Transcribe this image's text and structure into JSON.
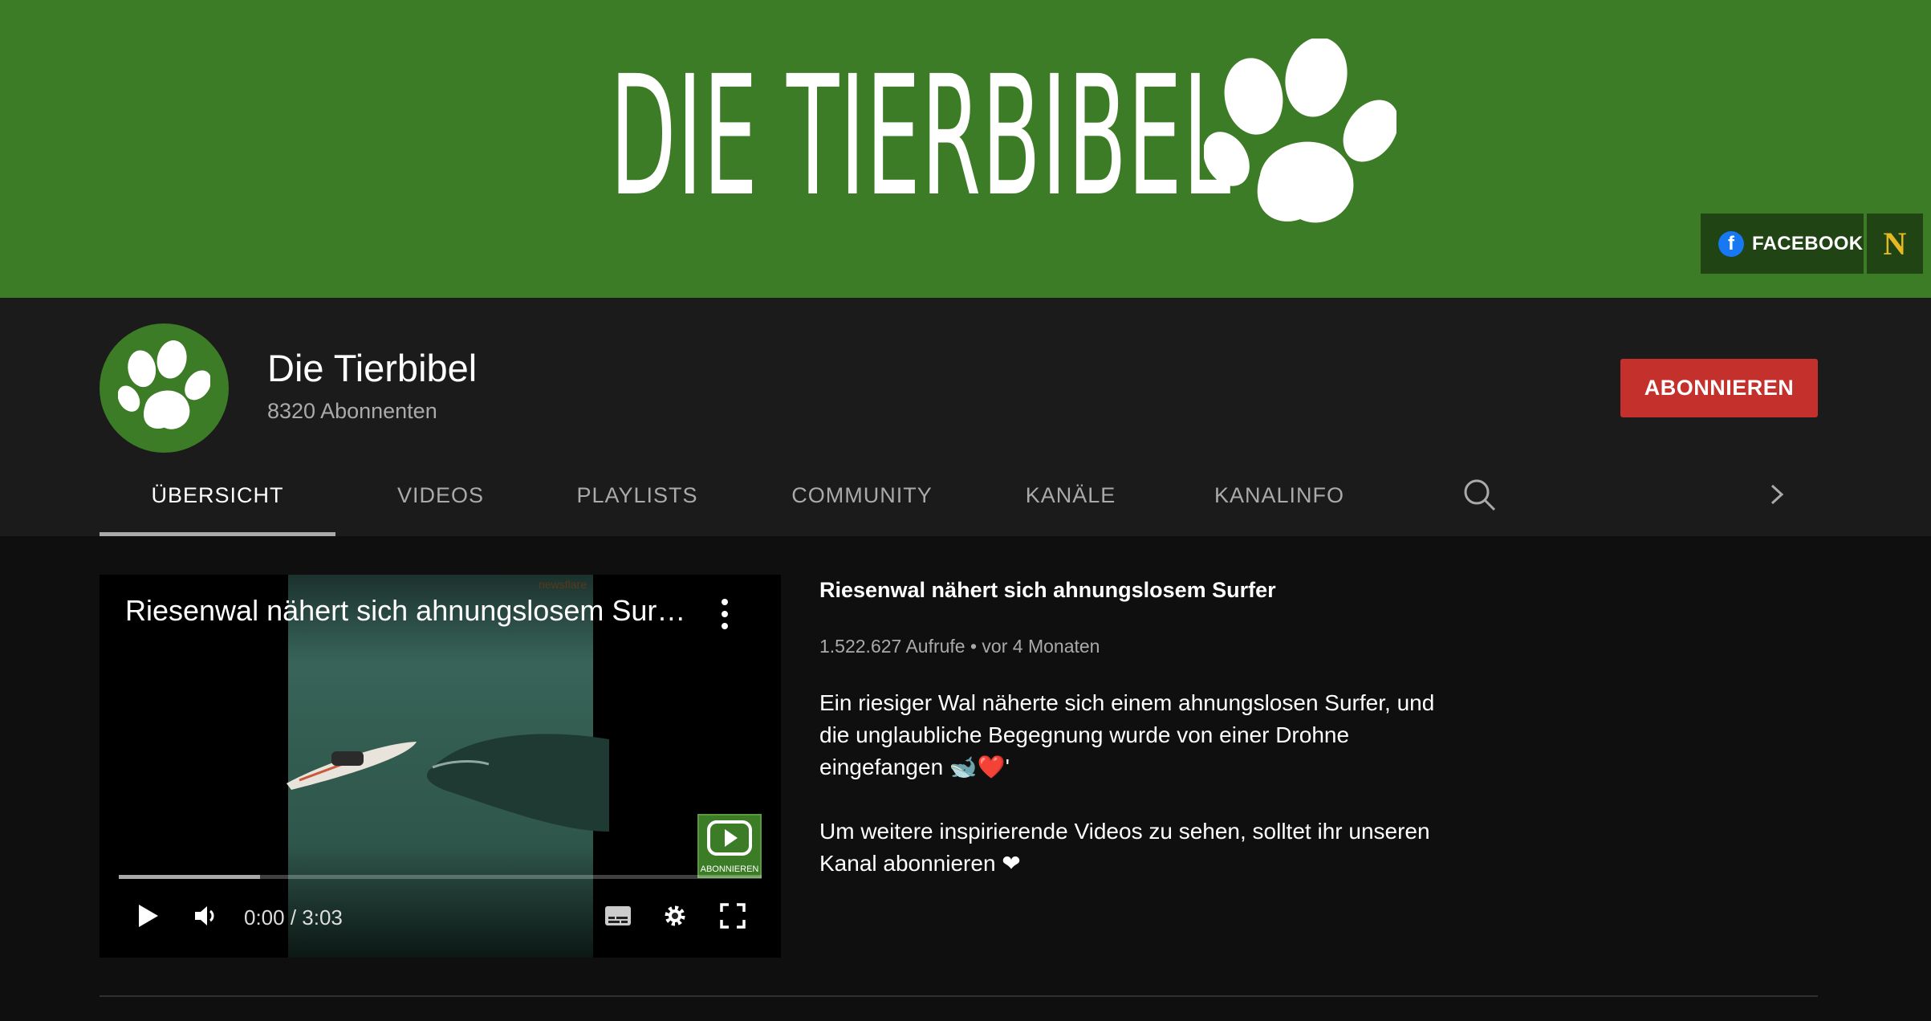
{
  "banner": {
    "title": "DIE TIERBIBEL",
    "links": [
      {
        "label": "FACEBOOK",
        "icon": "facebook-icon"
      },
      {
        "label": "N",
        "icon": "n-site-icon"
      }
    ]
  },
  "channel": {
    "name": "Die Tierbibel",
    "subscribers": "8320 Abonnenten",
    "subscribe_label": "ABONNIEREN"
  },
  "tabs": [
    {
      "label": "ÜBERSICHT",
      "active": true
    },
    {
      "label": "VIDEOS"
    },
    {
      "label": "PLAYLISTS"
    },
    {
      "label": "COMMUNITY"
    },
    {
      "label": "KANÄLE"
    },
    {
      "label": "KANALINFO"
    }
  ],
  "player": {
    "title": "Riesenwal nähert sich ahnungslosem Surf...",
    "time": "0:00 / 3:03",
    "watermark_label": "ABONNIEREN",
    "source_label": "newsflare",
    "progress": 0.22
  },
  "video": {
    "title": "Riesenwal nähert sich ahnungslosem Surfer",
    "meta": "1.522.627 Aufrufe • vor 4 Monaten",
    "description": "Ein riesiger Wal näherte sich einem ahnungslosen Surfer, und\ndie unglaubliche Begegnung wurde von einer Drohne\neingefangen 🐋❤️'\n\nUm weitere inspirierende Videos zu sehen, solltet ihr unseren\nKanal abonnieren ❤"
  },
  "colors": {
    "banner_green": "#3d7c26",
    "subscribe_red": "#c4302b",
    "background": "#0f0f0f",
    "header_bg": "#1b1b1b"
  }
}
